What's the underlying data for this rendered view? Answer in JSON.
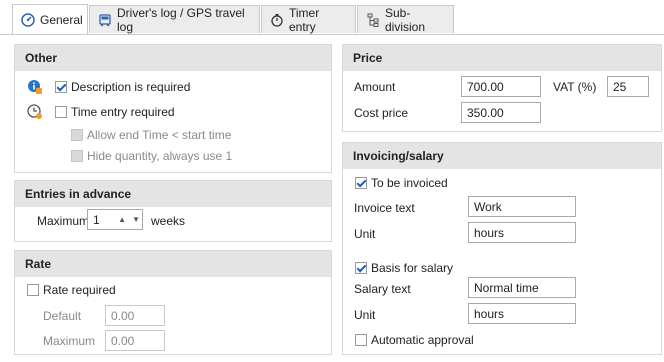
{
  "tabs": [
    {
      "label": "General",
      "icon": "gauge-icon",
      "active": true
    },
    {
      "label": "Driver's log / GPS travel log",
      "icon": "car-icon",
      "active": false
    },
    {
      "label": "Timer entry",
      "icon": "stopwatch-icon",
      "active": false
    },
    {
      "label": "Sub-division",
      "icon": "hierarchy-icon",
      "active": false
    }
  ],
  "other": {
    "title": "Other",
    "description_required": {
      "label": "Description is required",
      "checked": true
    },
    "time_entry_required": {
      "label": "Time entry required",
      "checked": false
    },
    "allow_end_time": {
      "label": "Allow end Time < start time",
      "checked": false,
      "enabled": false
    },
    "hide_quantity": {
      "label": "Hide quantity, always use 1",
      "checked": false,
      "enabled": false
    }
  },
  "entries": {
    "title": "Entries in advance",
    "maximum_label": "Maximum",
    "maximum_value": "1",
    "unit": "weeks"
  },
  "rate": {
    "title": "Rate",
    "rate_required": {
      "label": "Rate required",
      "checked": false
    },
    "default_label": "Default",
    "default_value": "0.00",
    "maximum_label": "Maximum",
    "maximum_value": "0.00"
  },
  "price": {
    "title": "Price",
    "amount_label": "Amount",
    "amount_value": "700.00",
    "vat_label": "VAT (%)",
    "vat_value": "25",
    "cost_label": "Cost price",
    "cost_value": "350.00"
  },
  "invoicing": {
    "title": "Invoicing/salary",
    "to_be_invoiced": {
      "label": "To be invoiced",
      "checked": true
    },
    "invoice_text_label": "Invoice text",
    "invoice_text_value": "Work",
    "unit_label": "Unit",
    "unit_value": "hours",
    "basis_for_salary": {
      "label": "Basis for salary",
      "checked": true
    },
    "salary_text_label": "Salary text",
    "salary_text_value": "Normal time",
    "unit2_label": "Unit",
    "unit2_value": "hours",
    "automatic_approval": {
      "label": "Automatic approval",
      "checked": false
    }
  },
  "colors": {
    "accent": "#1f5fb8",
    "header_bg": "#e4e4e4",
    "info": "#f0a020"
  }
}
